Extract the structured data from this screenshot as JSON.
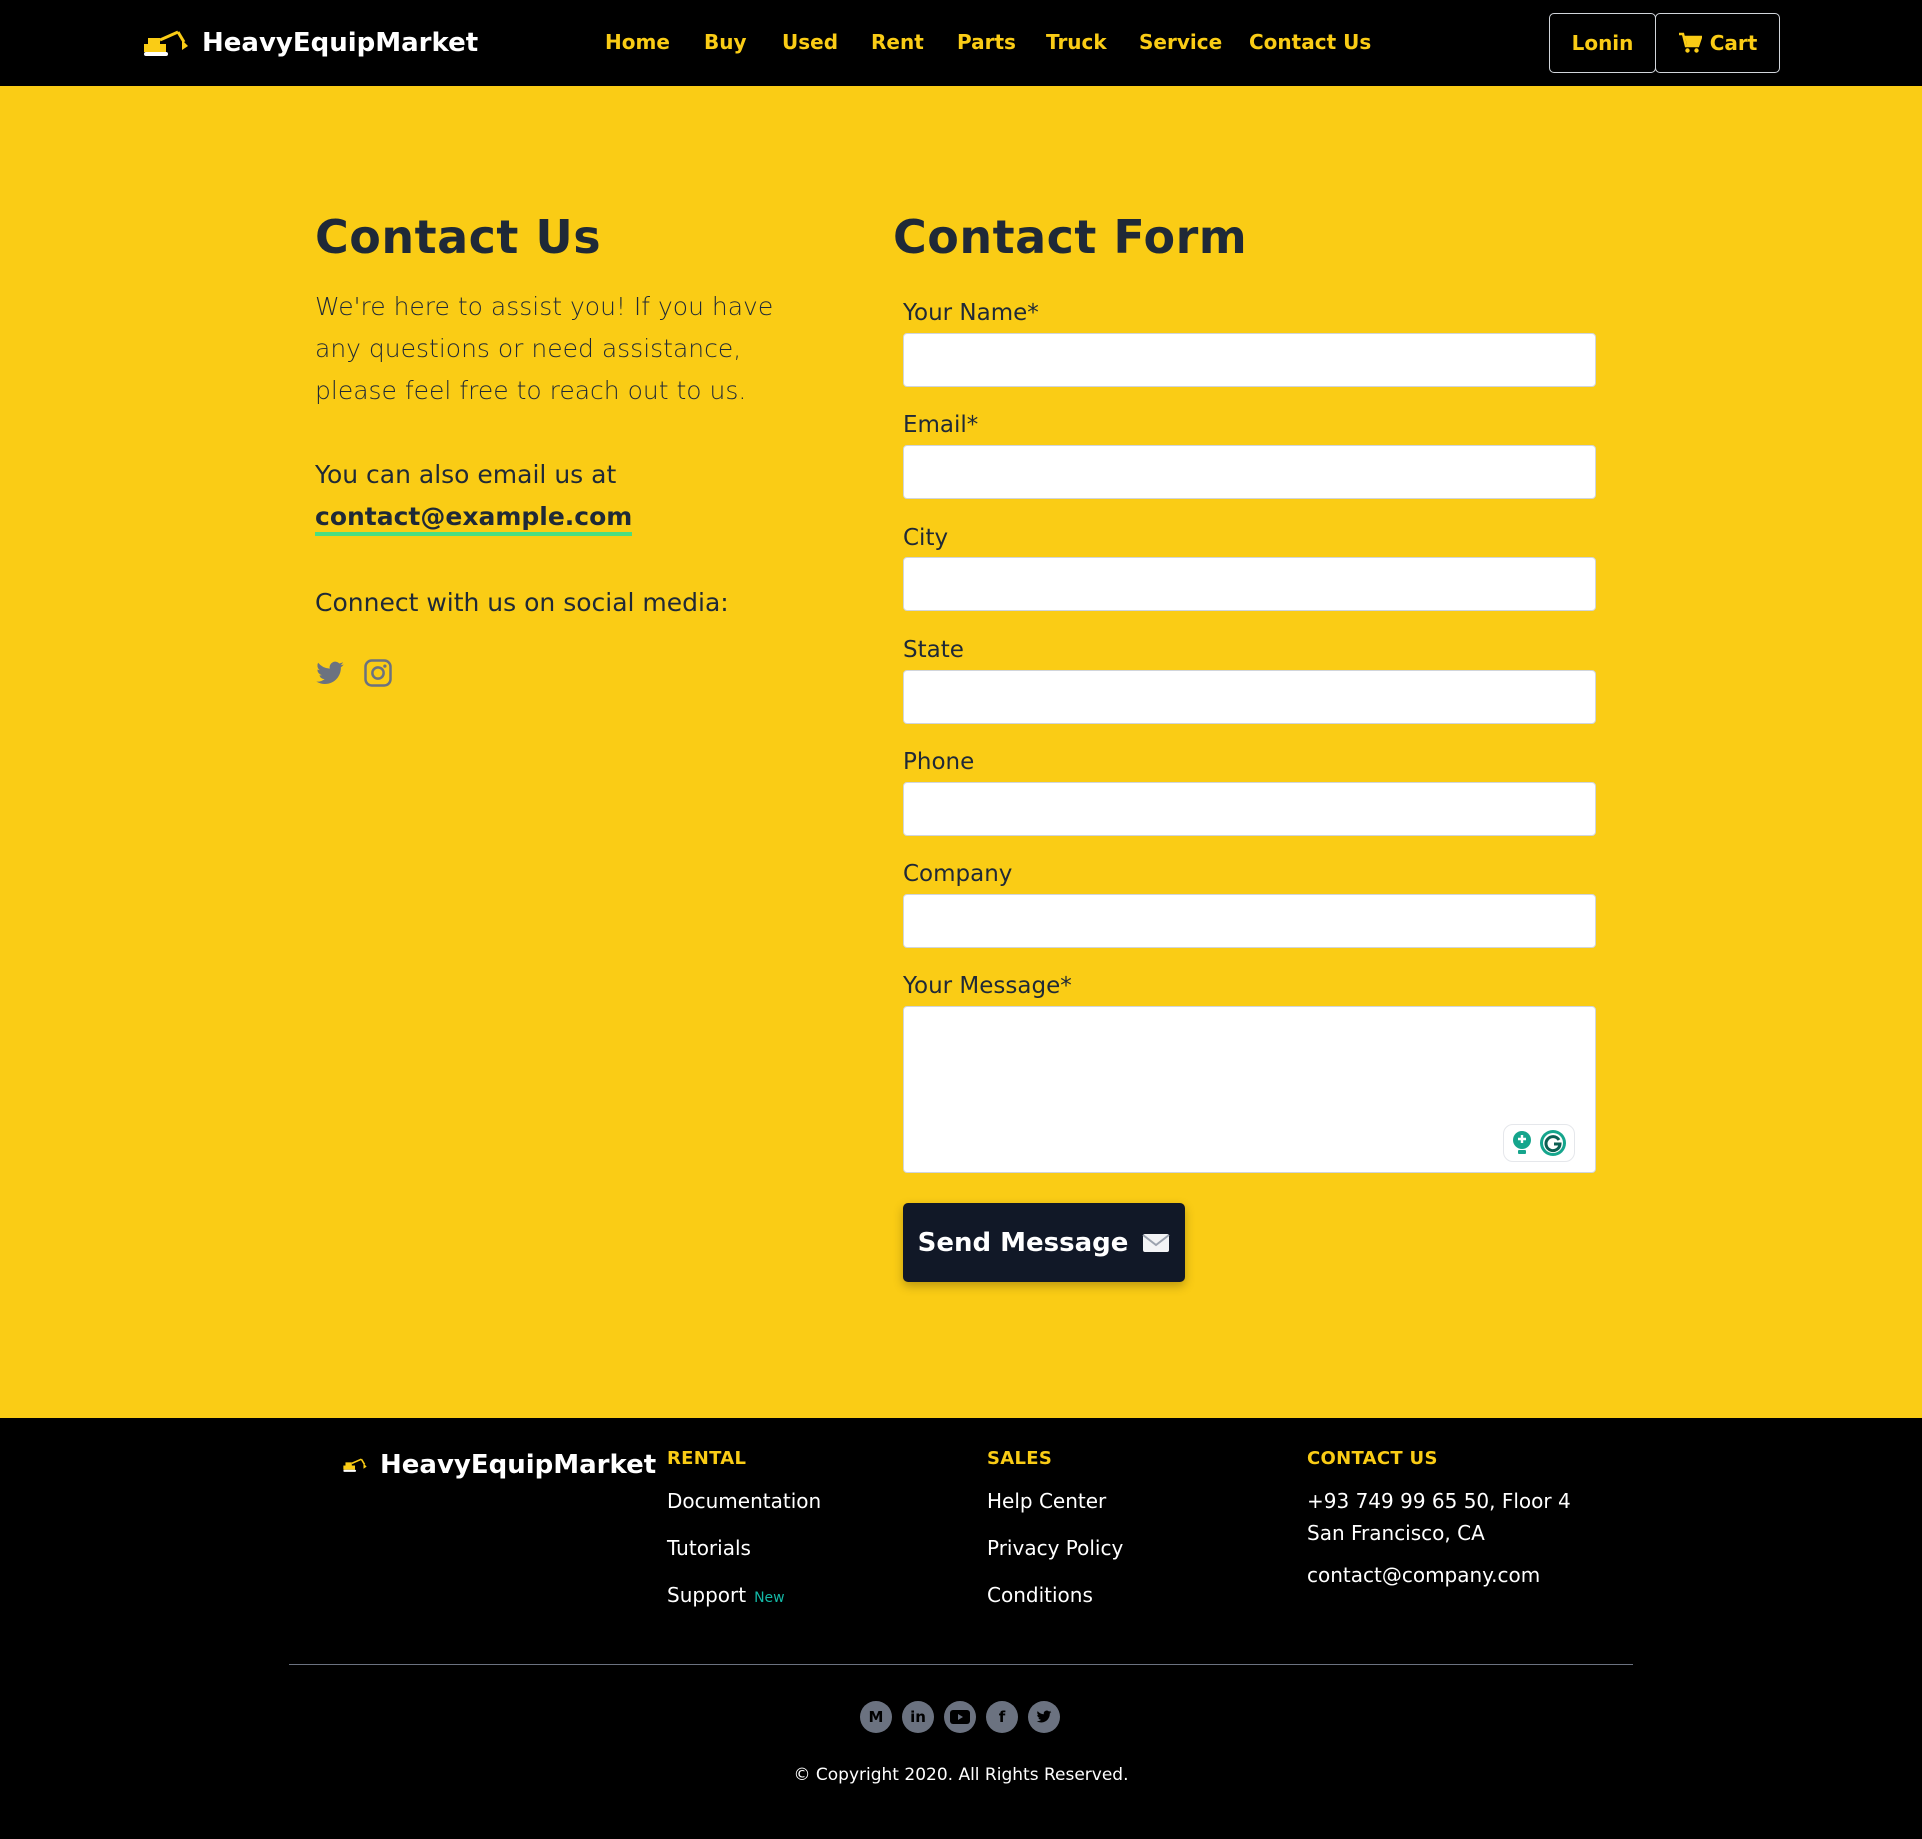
{
  "header": {
    "brand": "HeavyEquipMarket",
    "nav": [
      "Home",
      "Buy",
      "Used",
      "Rent",
      "Parts",
      "Truck",
      "Service",
      "Contact Us"
    ],
    "login_label": "Lonin",
    "cart_label": "Cart"
  },
  "contact": {
    "title": "Contact Us",
    "intro": "We're here to assist you! If you have any questions or need assistance, please feel free to reach out to us.",
    "email_prefix": "You can also email us at",
    "email": "contact@example.com",
    "social_text": "Connect with us on social media:"
  },
  "form": {
    "title": "Contact Form",
    "fields": [
      {
        "label": "Your Name*",
        "value": ""
      },
      {
        "label": "Email*",
        "value": ""
      },
      {
        "label": "City",
        "value": ""
      },
      {
        "label": "State",
        "value": ""
      },
      {
        "label": "Phone",
        "value": ""
      },
      {
        "label": "Company",
        "value": ""
      }
    ],
    "message_label": "Your Message*",
    "message_value": "",
    "submit_label": "Send Message"
  },
  "footer": {
    "brand": "HeavyEquipMarket",
    "columns": [
      {
        "heading": "RENTAL",
        "links": [
          "Documentation",
          "Tutorials",
          "Support"
        ],
        "badge": "New"
      },
      {
        "heading": "SALES",
        "links": [
          "Help Center",
          "Privacy Policy",
          "Conditions"
        ]
      }
    ],
    "contact": {
      "heading": "CONTACT US",
      "address_line1": "+93 749 99 65 50, Floor 4",
      "address_line2": "San Francisco, CA",
      "email": "contact@company.com"
    },
    "social_letters": {
      "medium": "M",
      "linkedin": "in",
      "facebook": "f"
    },
    "copyright": "© Copyright 2020. All Rights Reserved."
  },
  "colors": {
    "accent": "#facc15",
    "dark": "#000000",
    "button": "#111827",
    "underline": "#4ade80",
    "badge": "#14b8a6"
  }
}
